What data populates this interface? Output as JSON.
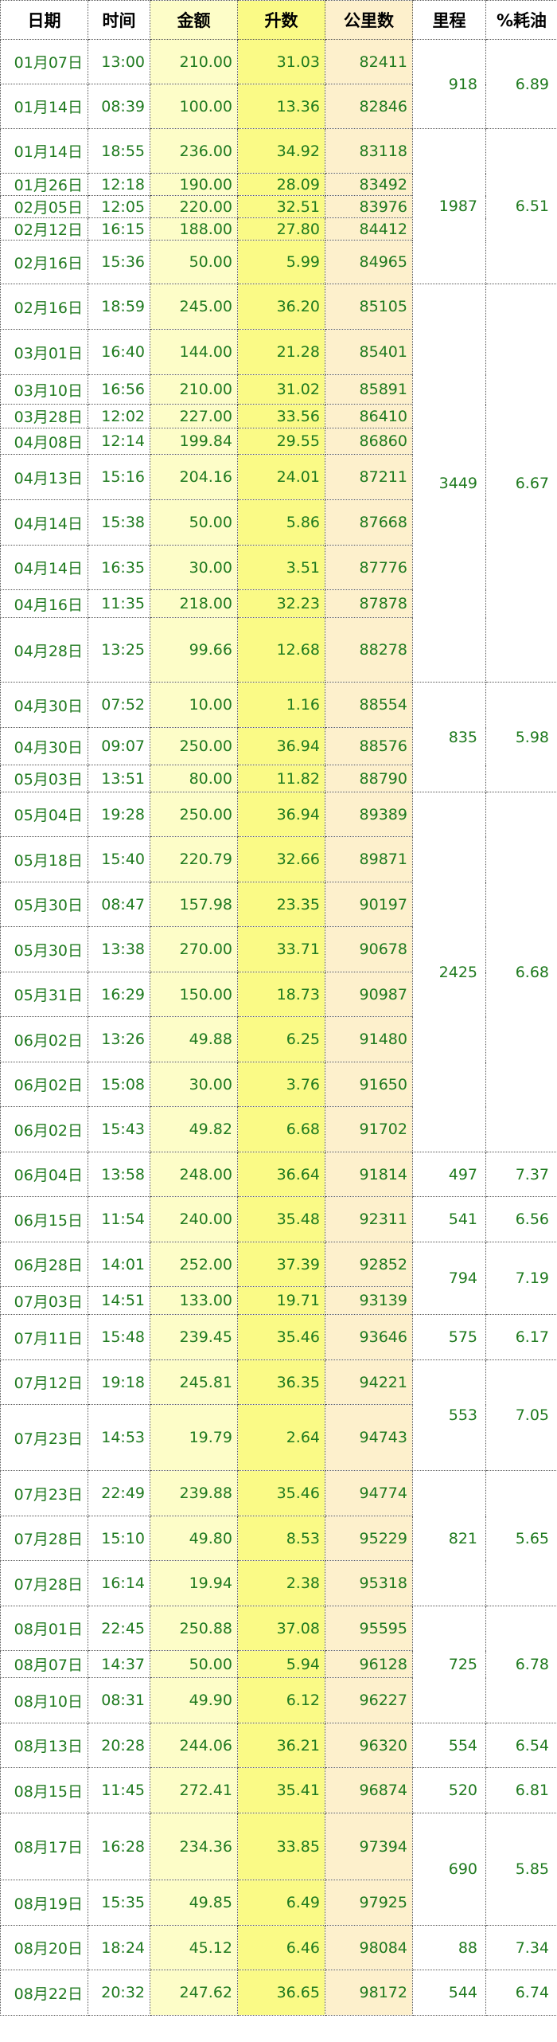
{
  "headers": [
    "日期",
    "时间",
    "金额",
    "升数",
    "公里数",
    "里程",
    "%耗油"
  ],
  "groups": [
    {
      "distance": "918",
      "consumption": "6.89",
      "rows": [
        {
          "date": "01月07日",
          "time": "13:00",
          "amount": "210.00",
          "liters": "31.03",
          "odometer": "82411",
          "h": 56
        },
        {
          "date": "01月14日",
          "time": "08:39",
          "amount": "100.00",
          "liters": "13.36",
          "odometer": "82846",
          "h": 56
        }
      ]
    },
    {
      "distance": "1987",
      "consumption": "6.51",
      "rows": [
        {
          "date": "01月14日",
          "time": "18:55",
          "amount": "236.00",
          "liters": "34.92",
          "odometer": "83118",
          "h": 56
        },
        {
          "date": "01月26日",
          "time": "12:18",
          "amount": "190.00",
          "liters": "28.09",
          "odometer": "83492",
          "h": 26
        },
        {
          "date": "02月05日",
          "time": "12:05",
          "amount": "220.00",
          "liters": "32.51",
          "odometer": "83976",
          "h": 26
        },
        {
          "date": "02月12日",
          "time": "16:15",
          "amount": "188.00",
          "liters": "27.80",
          "odometer": "84412",
          "h": 28
        },
        {
          "date": "02月16日",
          "time": "15:36",
          "amount": "50.00",
          "liters": "5.99",
          "odometer": "84965",
          "h": 55
        }
      ]
    },
    {
      "distance": "3449",
      "consumption": "6.67",
      "rows": [
        {
          "date": "02月16日",
          "time": "18:59",
          "amount": "245.00",
          "liters": "36.20",
          "odometer": "85105",
          "h": 57
        },
        {
          "date": "03月01日",
          "time": "16:40",
          "amount": "144.00",
          "liters": "21.28",
          "odometer": "85401",
          "h": 57
        },
        {
          "date": "03月10日",
          "time": "16:56",
          "amount": "210.00",
          "liters": "31.02",
          "odometer": "85891",
          "h": 37
        },
        {
          "date": "03月28日",
          "time": "12:02",
          "amount": "227.00",
          "liters": "33.56",
          "odometer": "86410",
          "h": 30
        },
        {
          "date": "04月08日",
          "time": "12:14",
          "amount": "199.84",
          "liters": "29.55",
          "odometer": "86860",
          "h": 33
        },
        {
          "date": "04月13日",
          "time": "15:16",
          "amount": "204.16",
          "liters": "24.01",
          "odometer": "87211",
          "h": 57
        },
        {
          "date": "04月14日",
          "time": "15:38",
          "amount": "50.00",
          "liters": "5.86",
          "odometer": "87668",
          "h": 57
        },
        {
          "date": "04月14日",
          "time": "16:35",
          "amount": "30.00",
          "liters": "3.51",
          "odometer": "87776",
          "h": 56
        },
        {
          "date": "04月16日",
          "time": "11:35",
          "amount": "218.00",
          "liters": "32.23",
          "odometer": "87878",
          "h": 35
        },
        {
          "date": "04月28日",
          "time": "13:25",
          "amount": "99.66",
          "liters": "12.68",
          "odometer": "88278",
          "h": 81
        }
      ]
    },
    {
      "distance": "835",
      "consumption": "5.98",
      "rows": [
        {
          "date": "04月30日",
          "time": "07:52",
          "amount": "10.00",
          "liters": "1.16",
          "odometer": "88554",
          "h": 57
        },
        {
          "date": "04月30日",
          "time": "09:07",
          "amount": "250.00",
          "liters": "36.94",
          "odometer": "88576",
          "h": 47
        },
        {
          "date": "05月03日",
          "time": "13:51",
          "amount": "80.00",
          "liters": "11.82",
          "odometer": "88790",
          "h": 34
        }
      ]
    },
    {
      "distance": "2425",
      "consumption": "6.68",
      "rows": [
        {
          "date": "05月04日",
          "time": "19:28",
          "amount": "250.00",
          "liters": "36.94",
          "odometer": "89389",
          "h": 56
        },
        {
          "date": "05月18日",
          "time": "15:40",
          "amount": "220.79",
          "liters": "32.66",
          "odometer": "89871",
          "h": 57
        },
        {
          "date": "05月30日",
          "time": "08:47",
          "amount": "157.98",
          "liters": "23.35",
          "odometer": "90197",
          "h": 56
        },
        {
          "date": "05月30日",
          "time": "13:38",
          "amount": "270.00",
          "liters": "33.71",
          "odometer": "90678",
          "h": 57
        },
        {
          "date": "05月31日",
          "time": "16:29",
          "amount": "150.00",
          "liters": "18.73",
          "odometer": "90987",
          "h": 56
        },
        {
          "date": "06月02日",
          "time": "13:26",
          "amount": "49.88",
          "liters": "6.25",
          "odometer": "91480",
          "h": 57
        },
        {
          "date": "06月02日",
          "time": "15:08",
          "amount": "30.00",
          "liters": "3.76",
          "odometer": "91650",
          "h": 56
        },
        {
          "date": "06月02日",
          "time": "15:43",
          "amount": "49.82",
          "liters": "6.68",
          "odometer": "91702",
          "h": 57
        }
      ]
    },
    {
      "distance": "497",
      "consumption": "7.37",
      "rows": [
        {
          "date": "06月04日",
          "time": "13:58",
          "amount": "248.00",
          "liters": "36.64",
          "odometer": "91814",
          "h": 56
        }
      ]
    },
    {
      "distance": "541",
      "consumption": "6.56",
      "rows": [
        {
          "date": "06月15日",
          "time": "11:54",
          "amount": "240.00",
          "liters": "35.48",
          "odometer": "92311",
          "h": 57
        }
      ]
    },
    {
      "distance": "794",
      "consumption": "7.19",
      "rows": [
        {
          "date": "06月28日",
          "time": "14:01",
          "amount": "252.00",
          "liters": "37.39",
          "odometer": "92852",
          "h": 56
        },
        {
          "date": "07月03日",
          "time": "14:51",
          "amount": "133.00",
          "liters": "19.71",
          "odometer": "93139",
          "h": 35
        }
      ]
    },
    {
      "distance": "575",
      "consumption": "6.17",
      "rows": [
        {
          "date": "07月11日",
          "time": "15:48",
          "amount": "239.45",
          "liters": "35.46",
          "odometer": "93646",
          "h": 57
        }
      ]
    },
    {
      "distance": "553",
      "consumption": "7.05",
      "rows": [
        {
          "date": "07月12日",
          "time": "19:18",
          "amount": "245.81",
          "liters": "36.35",
          "odometer": "94221",
          "h": 56
        },
        {
          "date": "07月23日",
          "time": "14:53",
          "amount": "19.79",
          "liters": "2.64",
          "odometer": "94743",
          "h": 83
        }
      ]
    },
    {
      "distance": "821",
      "consumption": "5.65",
      "rows": [
        {
          "date": "07月23日",
          "time": "22:49",
          "amount": "239.88",
          "liters": "35.46",
          "odometer": "94774",
          "h": 57
        },
        {
          "date": "07月28日",
          "time": "15:10",
          "amount": "49.80",
          "liters": "8.53",
          "odometer": "95229",
          "h": 56
        },
        {
          "date": "07月28日",
          "time": "16:14",
          "amount": "19.94",
          "liters": "2.38",
          "odometer": "95318",
          "h": 57
        }
      ]
    },
    {
      "distance": "725",
      "consumption": "6.78",
      "rows": [
        {
          "date": "08月01日",
          "time": "22:45",
          "amount": "250.88",
          "liters": "37.08",
          "odometer": "95595",
          "h": 56
        },
        {
          "date": "08月07日",
          "time": "14:37",
          "amount": "50.00",
          "liters": "5.94",
          "odometer": "96128",
          "h": 34
        },
        {
          "date": "08月10日",
          "time": "08:31",
          "amount": "49.90",
          "liters": "6.12",
          "odometer": "96227",
          "h": 57
        }
      ]
    },
    {
      "distance": "554",
      "consumption": "6.54",
      "rows": [
        {
          "date": "08月13日",
          "time": "20:28",
          "amount": "244.06",
          "liters": "36.21",
          "odometer": "96320",
          "h": 56
        }
      ]
    },
    {
      "distance": "520",
      "consumption": "6.81",
      "rows": [
        {
          "date": "08月15日",
          "time": "11:45",
          "amount": "272.41",
          "liters": "35.41",
          "odometer": "96874",
          "h": 57
        }
      ]
    },
    {
      "distance": "690",
      "consumption": "5.85",
      "rows": [
        {
          "date": "08月17日",
          "time": "16:28",
          "amount": "234.36",
          "liters": "33.85",
          "odometer": "97394",
          "h": 84
        },
        {
          "date": "08月19日",
          "time": "15:35",
          "amount": "49.85",
          "liters": "6.49",
          "odometer": "97925",
          "h": 57
        }
      ]
    },
    {
      "distance": "88",
      "consumption": "7.34",
      "rows": [
        {
          "date": "08月20日",
          "time": "18:24",
          "amount": "45.12",
          "liters": "6.46",
          "odometer": "98084",
          "h": 56
        }
      ]
    },
    {
      "distance": "544",
      "consumption": "6.74",
      "rows": [
        {
          "date": "08月22日",
          "time": "20:32",
          "amount": "247.62",
          "liters": "36.65",
          "odometer": "98172",
          "h": 57
        }
      ]
    }
  ]
}
